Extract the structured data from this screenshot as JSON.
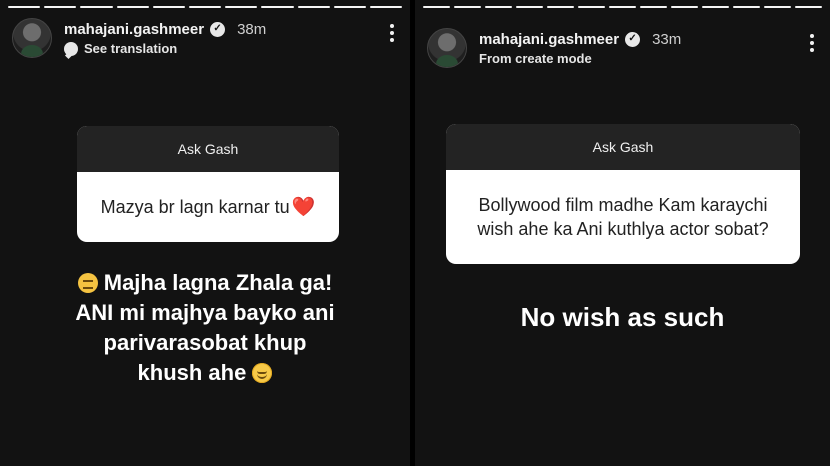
{
  "left_story": {
    "progress": {
      "segments": 11,
      "completed": 11
    },
    "username": "mahajani.gashmeer",
    "verified_icon": "verified-badge-icon",
    "time": "38m",
    "subtitle": "See translation",
    "question_card": {
      "heading": "Ask Gash",
      "question": "Mazya br lagn karnar tu",
      "question_emoji": "❤️"
    },
    "answer": {
      "line1": "Majha lagna Zhala ga!",
      "line2": "ANI mi majhya bayko ani",
      "line3": "parivarasobat khup",
      "line4": "khush ahe",
      "emoji_start": "😔",
      "emoji_end": "😊"
    }
  },
  "right_story": {
    "progress": {
      "segments": 13,
      "completed": 13
    },
    "username": "mahajani.gashmeer",
    "verified_icon": "verified-badge-icon",
    "time": "33m",
    "subtitle": "From create mode",
    "question_card": {
      "heading": "Ask Gash",
      "question_line1": "Bollywood film madhe Kam karaychi",
      "question_line2": "wish ahe ka Ani kuthlya actor sobat?"
    },
    "answer": "No wish as such"
  },
  "colors": {
    "background": "#121212",
    "card_header": "#232323",
    "card_body": "#ffffff",
    "heart": "#e0242f"
  }
}
